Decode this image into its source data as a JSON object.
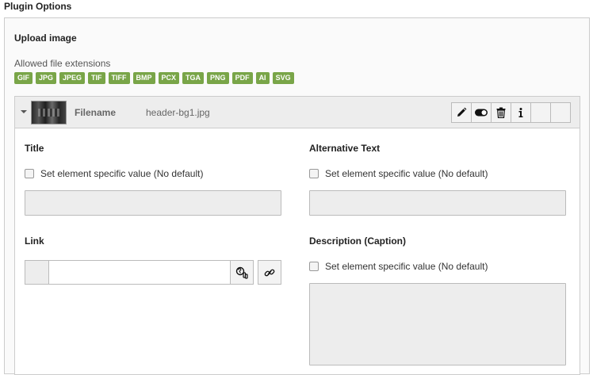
{
  "plugin_options_title": "Plugin Options",
  "upload": {
    "title": "Upload image",
    "allowed_label": "Allowed file extensions",
    "extensions": [
      "GIF",
      "JPG",
      "JPEG",
      "TIF",
      "TIFF",
      "BMP",
      "PCX",
      "TGA",
      "PNG",
      "PDF",
      "AI",
      "SVG"
    ]
  },
  "file": {
    "filename_label": "Filename",
    "filename_value": "header-bg1.jpg",
    "buttons": [
      "edit-icon",
      "toggle-icon",
      "trash-icon",
      "info-icon",
      "empty",
      "empty"
    ]
  },
  "form": {
    "title_label": "Title",
    "alt_label": "Alternative Text",
    "link_label": "Link",
    "description_label": "Description (Caption)",
    "element_specific": "Set element specific value (No default)"
  },
  "colors": {
    "badge_bg": "#79a548",
    "header_bg": "#ededed",
    "border": "#cccccc"
  }
}
